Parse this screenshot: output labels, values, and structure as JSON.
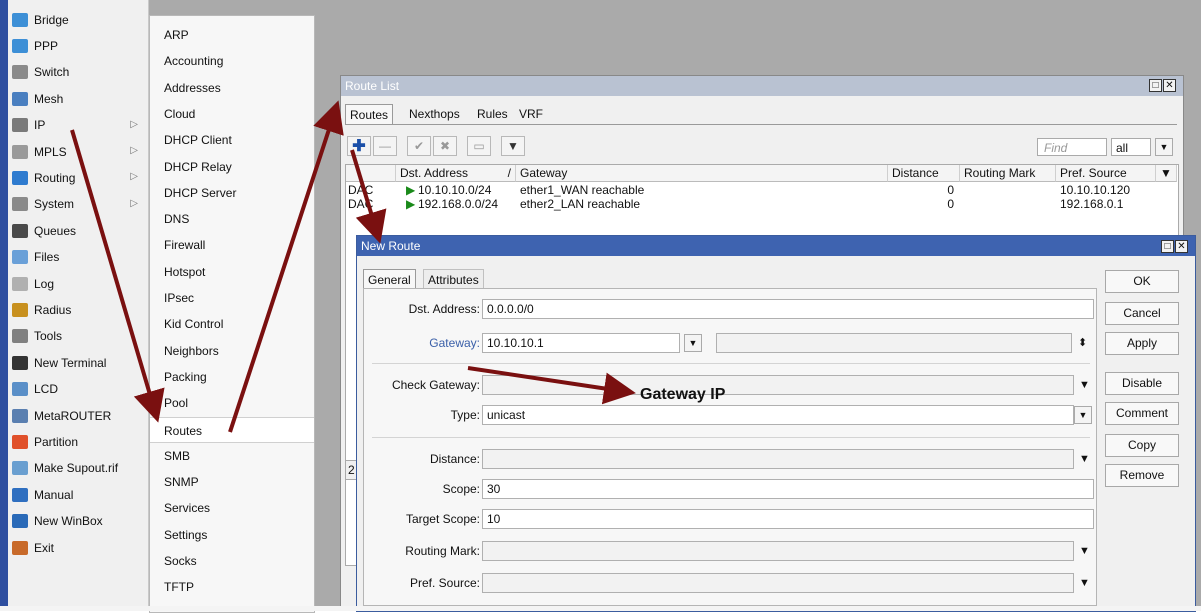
{
  "main_menu": {
    "items": [
      {
        "label": "Bridge",
        "icon": "bridge-icon",
        "color": "#3d8fd6"
      },
      {
        "label": "PPP",
        "icon": "ppp-icon",
        "color": "#3d8fd6"
      },
      {
        "label": "Switch",
        "icon": "switch-icon",
        "color": "#8a8a8a"
      },
      {
        "label": "Mesh",
        "icon": "mesh-icon",
        "color": "#4a7fc0"
      },
      {
        "label": "IP",
        "icon": "ip-icon",
        "color": "#7a7a7a",
        "arrow": "▷"
      },
      {
        "label": "MPLS",
        "icon": "mpls-icon",
        "color": "#9a9a9a",
        "arrow": "▷"
      },
      {
        "label": "Routing",
        "icon": "routing-icon",
        "color": "#2e7bcf",
        "arrow": "▷"
      },
      {
        "label": "System",
        "icon": "system-icon",
        "color": "#8a8a8a",
        "arrow": "▷"
      },
      {
        "label": "Queues",
        "icon": "queues-icon",
        "color": "#4a4a4a"
      },
      {
        "label": "Files",
        "icon": "files-icon",
        "color": "#6aa0d8"
      },
      {
        "label": "Log",
        "icon": "log-icon",
        "color": "#b0b0b0"
      },
      {
        "label": "Radius",
        "icon": "radius-icon",
        "color": "#c8901e"
      },
      {
        "label": "Tools",
        "icon": "tools-icon",
        "color": "#808080"
      },
      {
        "label": "New Terminal",
        "icon": "terminal-icon",
        "color": "#333333"
      },
      {
        "label": "LCD",
        "icon": "lcd-icon",
        "color": "#5a8fc8"
      },
      {
        "label": "MetaROUTER",
        "icon": "metarouter-icon",
        "color": "#5a7fb0"
      },
      {
        "label": "Partition",
        "icon": "partition-icon",
        "color": "#e0502a"
      },
      {
        "label": "Make Supout.rif",
        "icon": "supout-icon",
        "color": "#6a9fd0"
      },
      {
        "label": "Manual",
        "icon": "manual-icon",
        "color": "#2f6fc0"
      },
      {
        "label": "New WinBox",
        "icon": "winbox-icon",
        "color": "#2a6ab8"
      },
      {
        "label": "Exit",
        "icon": "exit-icon",
        "color": "#c86a2a"
      }
    ]
  },
  "submenu": {
    "items": [
      "ARP",
      "Accounting",
      "Addresses",
      "Cloud",
      "DHCP Client",
      "DHCP Relay",
      "DHCP Server",
      "DNS",
      "Firewall",
      "Hotspot",
      "IPsec",
      "Kid Control",
      "Neighbors",
      "Packing",
      "Pool",
      "Routes",
      "SMB",
      "SNMP",
      "Services",
      "Settings",
      "Socks",
      "TFTP"
    ],
    "selected": "Routes"
  },
  "route_list": {
    "title": "Route List",
    "close_glyph": "□✕",
    "tabs": [
      "Routes",
      "Nexthops",
      "Rules",
      "VRF"
    ],
    "find_placeholder": "Find",
    "filter_value": "all",
    "columns": [
      "Dst. Address",
      "/",
      "Gateway",
      "Distance",
      "Routing Mark",
      "Pref. Source"
    ],
    "rows": [
      {
        "flags": "DAC",
        "dst": "10.10.10.0/24",
        "gateway": "ether1_WAN reachable",
        "distance": "0",
        "mark": "",
        "pref": "10.10.10.120"
      },
      {
        "flags": "DAC",
        "dst": "192.168.0.0/24",
        "gateway": "ether2_LAN reachable",
        "distance": "0",
        "mark": "",
        "pref": "192.168.0.1"
      }
    ],
    "count_text": "2"
  },
  "new_route": {
    "title": "New Route",
    "close_glyph": "□✕",
    "tabs": [
      "General",
      "Attributes"
    ],
    "fields": {
      "dst_address": {
        "label": "Dst. Address:",
        "value": "0.0.0.0/0"
      },
      "gateway": {
        "label": "Gateway:",
        "value": "10.10.10.1"
      },
      "check_gateway": {
        "label": "Check Gateway:",
        "value": ""
      },
      "type": {
        "label": "Type:",
        "value": "unicast"
      },
      "distance": {
        "label": "Distance:",
        "value": ""
      },
      "scope": {
        "label": "Scope:",
        "value": "30"
      },
      "target_scope": {
        "label": "Target Scope:",
        "value": "10"
      },
      "routing_mark": {
        "label": "Routing Mark:",
        "value": ""
      },
      "pref_source": {
        "label": "Pref. Source:",
        "value": ""
      }
    },
    "buttons": [
      "OK",
      "Cancel",
      "Apply",
      "Disable",
      "Comment",
      "Copy",
      "Remove"
    ]
  },
  "annotation": {
    "text": "Gateway IP",
    "arrow_color": "#7a1010"
  }
}
